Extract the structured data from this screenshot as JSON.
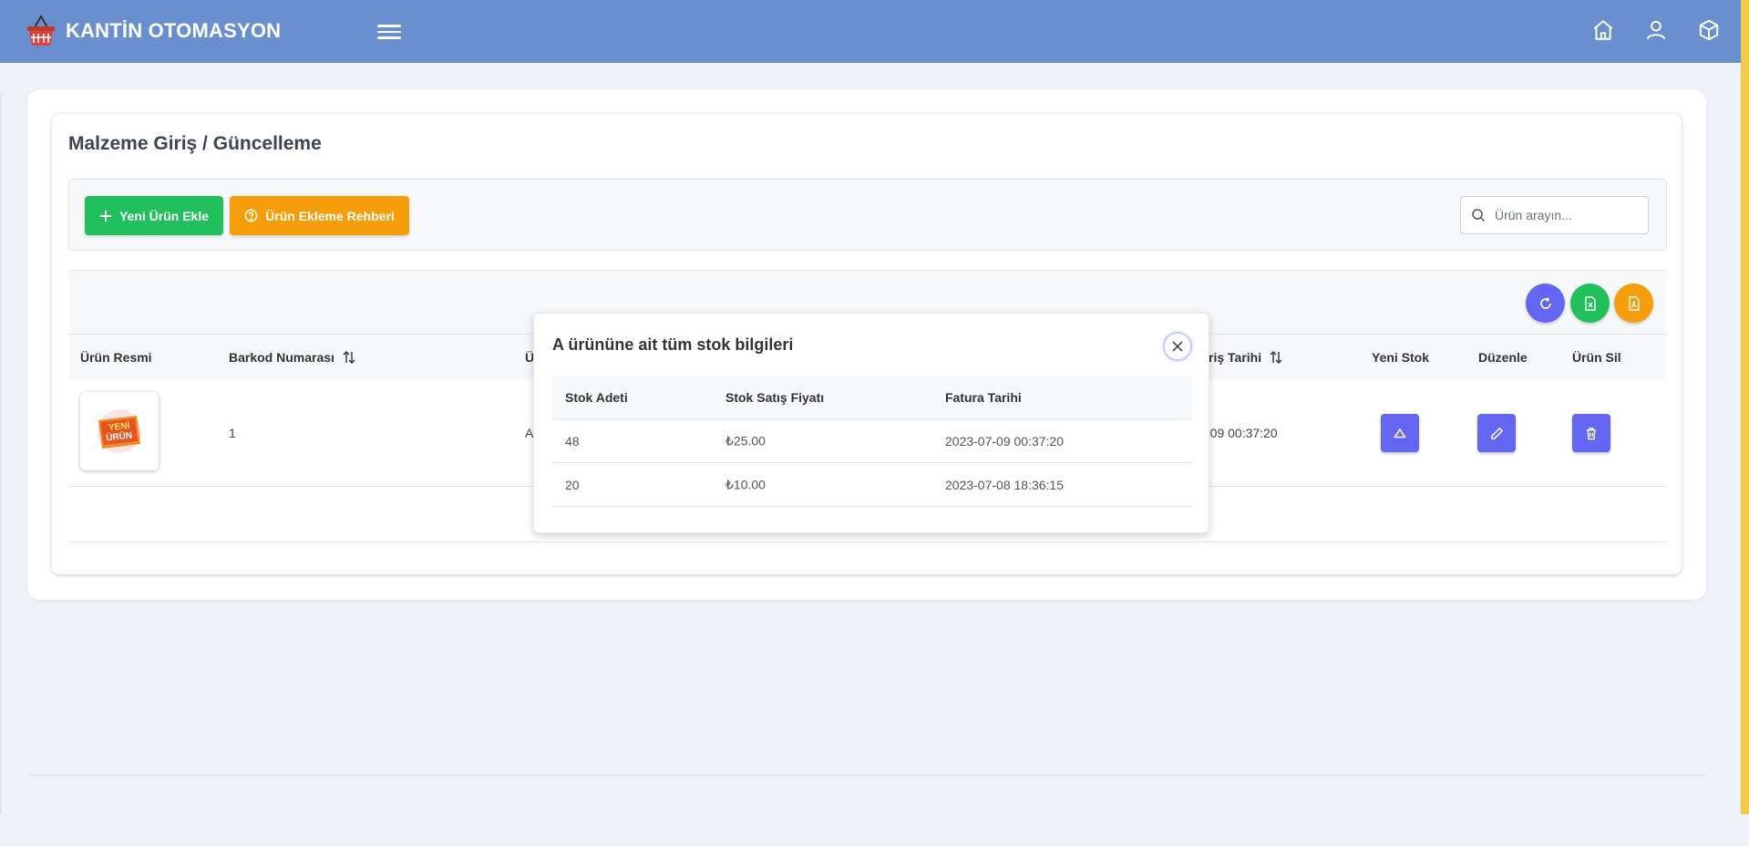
{
  "app": {
    "brand": "KANTİN OTOMASYON",
    "logo_icon": "basket-icon",
    "nav_icons": [
      "home-icon",
      "user-icon",
      "box-icon"
    ]
  },
  "page": {
    "title": "Malzeme Giriş / Güncelleme",
    "add_button": "Yeni Ürün Ekle",
    "guide_button": "Ürün Ekleme Rehberi",
    "search_placeholder": "Ürün arayın...",
    "action_icons": [
      "refresh-icon",
      "excel-export-icon",
      "pdf-export-icon"
    ]
  },
  "table": {
    "headers": {
      "image": "Ürün Resmi",
      "barcode": "Barkod Numarası",
      "name_partial": "Ü",
      "date_partial": "riş Tarihi",
      "new_stock": "Yeni Stok",
      "edit": "Düzenle",
      "delete": "Ürün Sil"
    },
    "rows": [
      {
        "image_text_top": "YENİ",
        "image_text_bottom": "ÜRÜN",
        "barcode": "1",
        "name_partial": "A",
        "date_partial": "-09 00:37:20"
      }
    ]
  },
  "modal": {
    "title": "A ürününe ait tüm stok bilgileri",
    "columns": [
      "Stok Adeti",
      "Stok Satış Fiyatı",
      "Fatura Tarihi"
    ],
    "rows": [
      {
        "qty": "48",
        "price": "₺25.00",
        "date": "2023-07-09 00:37:20"
      },
      {
        "qty": "20",
        "price": "₺10.00",
        "date": "2023-07-08 18:36:15"
      }
    ]
  },
  "colors": {
    "topbar": "#6a8fcf",
    "primary": "#6366f1",
    "success": "#22c05c",
    "warning": "#f59d0a"
  }
}
